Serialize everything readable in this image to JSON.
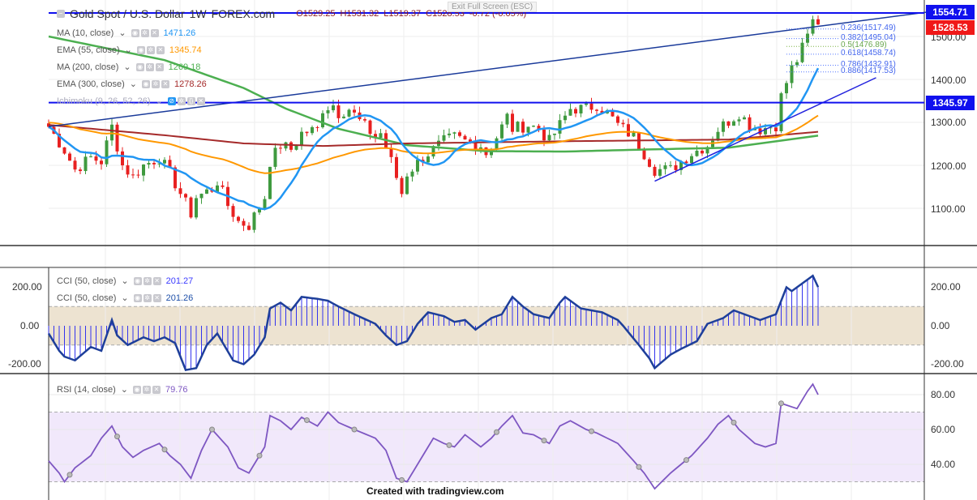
{
  "header": {
    "symbol": "Gold Spot / U.S. Dollar",
    "interval": "1W",
    "source": "FOREX.com",
    "open": "O1529.25",
    "high": "H1531.32",
    "low": "L1519.37",
    "close": "C1528.53",
    "change": "-0.72 (-0.05%)",
    "exit_fullscreen": "Exit Full Screen (ESC)"
  },
  "legends": {
    "ma10": {
      "label": "MA (10, close)",
      "value": "1471.26",
      "color": "#2196f3"
    },
    "ema55": {
      "label": "EMA (55, close)",
      "value": "1345.74",
      "color": "#ff9800"
    },
    "ma200": {
      "label": "MA (200, close)",
      "value": "1269.18",
      "color": "#4caf50"
    },
    "ema300": {
      "label": "EMA (300, close)",
      "value": "1278.26",
      "color": "#a52a2a"
    },
    "ichimoku": {
      "label": "Ichimoku (9, 26, 52, 26)"
    },
    "cci1": {
      "label": "CCI (50, close)",
      "value": "201.27"
    },
    "cci2": {
      "label": "CCI (50, close)",
      "value": "201.26"
    },
    "rsi": {
      "label": "RSI (14, close)",
      "value": "79.76"
    }
  },
  "price_tags": {
    "top": "1554.71",
    "last": "1528.53",
    "support": "1345.97"
  },
  "fib_levels": [
    {
      "label": "0.236(1517.49)",
      "price": 1517.49
    },
    {
      "label": "0.382(1495.04)",
      "price": 1495.04
    },
    {
      "label": "0.5(1476.89)",
      "price": 1476.89
    },
    {
      "label": "0.618(1458.74)",
      "price": 1458.74
    },
    {
      "label": "0.786(1432.91)",
      "price": 1432.91
    },
    {
      "label": "0.886(1417.53)",
      "price": 1417.53
    }
  ],
  "credit": "Created with tradingview.com",
  "chart_data": {
    "type": "line",
    "title": "Gold Spot / U.S. Dollar 1W",
    "price_axis": {
      "ticks": [
        "1500.00",
        "1400.00",
        "1300.00",
        "1200.00",
        "1100.00"
      ],
      "values": [
        1500,
        1400,
        1300,
        1200,
        1100
      ]
    },
    "cci_axis": {
      "ticks": [
        "200.00",
        "0.00",
        "-200.00"
      ],
      "values": [
        200,
        0,
        -200
      ],
      "band": [
        -100,
        100
      ]
    },
    "rsi_axis": {
      "ticks": [
        "80.00",
        "60.00",
        "40.00"
      ],
      "values": [
        80,
        60,
        40
      ],
      "band": [
        30,
        70
      ]
    },
    "weeks": 146,
    "close_path": [
      [
        0,
        1290
      ],
      [
        3,
        1235
      ],
      [
        5,
        1190
      ],
      [
        8,
        1218
      ],
      [
        10,
        1209
      ],
      [
        12,
        1290
      ],
      [
        14,
        1200
      ],
      [
        16,
        1173
      ],
      [
        18,
        1200
      ],
      [
        21,
        1218
      ],
      [
        23,
        1181
      ],
      [
        25,
        1135
      ],
      [
        27,
        1088
      ],
      [
        28,
        1126
      ],
      [
        31,
        1145
      ],
      [
        32,
        1163
      ],
      [
        34,
        1107
      ],
      [
        36,
        1069
      ],
      [
        38,
        1060
      ],
      [
        41,
        1126
      ],
      [
        42,
        1209
      ],
      [
        44,
        1247
      ],
      [
        46,
        1237
      ],
      [
        48,
        1275
      ],
      [
        51,
        1284
      ],
      [
        52,
        1332
      ],
      [
        54,
        1341
      ],
      [
        55,
        1322
      ],
      [
        57,
        1332
      ],
      [
        59,
        1303
      ],
      [
        62,
        1266
      ],
      [
        63,
        1275
      ],
      [
        65,
        1209
      ],
      [
        67,
        1135
      ],
      [
        68,
        1181
      ],
      [
        71,
        1218
      ],
      [
        73,
        1237
      ],
      [
        75,
        1256
      ],
      [
        77,
        1266
      ],
      [
        79,
        1256
      ],
      [
        82,
        1247
      ],
      [
        83,
        1228
      ],
      [
        85,
        1266
      ],
      [
        87,
        1313
      ],
      [
        88,
        1285
      ],
      [
        91,
        1294
      ],
      [
        93,
        1285
      ],
      [
        95,
        1256
      ],
      [
        98,
        1313
      ],
      [
        99,
        1332
      ],
      [
        102,
        1332
      ],
      [
        104,
        1341
      ],
      [
        106,
        1322
      ],
      [
        108,
        1294
      ],
      [
        111,
        1266
      ],
      [
        113,
        1228
      ],
      [
        115,
        1190
      ],
      [
        118,
        1190
      ],
      [
        120,
        1209
      ],
      [
        122,
        1228
      ],
      [
        125,
        1247
      ],
      [
        127,
        1284
      ],
      [
        129,
        1303
      ],
      [
        131,
        1322
      ],
      [
        133,
        1294
      ],
      [
        135,
        1284
      ],
      [
        138,
        1294
      ],
      [
        139,
        1360
      ],
      [
        141,
        1426
      ],
      [
        142,
        1445
      ],
      [
        144,
        1500
      ],
      [
        145,
        1540
      ],
      [
        146,
        1528
      ]
    ],
    "ma200_path": [
      [
        0,
        1500
      ],
      [
        22,
        1445
      ],
      [
        37,
        1380
      ],
      [
        45,
        1332
      ],
      [
        55,
        1285
      ],
      [
        68,
        1247
      ],
      [
        83,
        1233
      ],
      [
        98,
        1232
      ],
      [
        114,
        1237
      ],
      [
        129,
        1241
      ],
      [
        146,
        1269
      ]
    ],
    "ema300_path": [
      [
        0,
        1294
      ],
      [
        22,
        1270
      ],
      [
        37,
        1251
      ],
      [
        52,
        1245
      ],
      [
        68,
        1251
      ],
      [
        98,
        1256
      ],
      [
        129,
        1260
      ],
      [
        146,
        1278
      ]
    ],
    "cci_path": [
      [
        0,
        -40
      ],
      [
        2,
        -130
      ],
      [
        3,
        -160
      ],
      [
        5,
        -180
      ],
      [
        8,
        -110
      ],
      [
        10,
        -130
      ],
      [
        12,
        30
      ],
      [
        13,
        -50
      ],
      [
        15,
        -100
      ],
      [
        18,
        -60
      ],
      [
        20,
        -80
      ],
      [
        22,
        -60
      ],
      [
        24,
        -90
      ],
      [
        26,
        -230
      ],
      [
        28,
        -220
      ],
      [
        30,
        -100
      ],
      [
        32,
        -40
      ],
      [
        35,
        -180
      ],
      [
        37,
        -200
      ],
      [
        39,
        -150
      ],
      [
        41,
        -60
      ],
      [
        42,
        90
      ],
      [
        44,
        120
      ],
      [
        46,
        80
      ],
      [
        48,
        150
      ],
      [
        51,
        140
      ],
      [
        53,
        130
      ],
      [
        55,
        100
      ],
      [
        58,
        60
      ],
      [
        62,
        10
      ],
      [
        64,
        -50
      ],
      [
        66,
        -100
      ],
      [
        68,
        -80
      ],
      [
        70,
        10
      ],
      [
        72,
        70
      ],
      [
        75,
        50
      ],
      [
        77,
        20
      ],
      [
        79,
        30
      ],
      [
        81,
        -20
      ],
      [
        84,
        40
      ],
      [
        86,
        60
      ],
      [
        88,
        150
      ],
      [
        90,
        100
      ],
      [
        92,
        60
      ],
      [
        95,
        40
      ],
      [
        97,
        120
      ],
      [
        98,
        150
      ],
      [
        101,
        90
      ],
      [
        103,
        80
      ],
      [
        105,
        70
      ],
      [
        108,
        30
      ],
      [
        109,
        0
      ],
      [
        112,
        -100
      ],
      [
        114,
        -170
      ],
      [
        115,
        -220
      ],
      [
        118,
        -150
      ],
      [
        120,
        -120
      ],
      [
        123,
        -80
      ],
      [
        125,
        10
      ],
      [
        128,
        40
      ],
      [
        130,
        80
      ],
      [
        132,
        60
      ],
      [
        135,
        30
      ],
      [
        137,
        50
      ],
      [
        138,
        60
      ],
      [
        140,
        200
      ],
      [
        141,
        180
      ],
      [
        144,
        240
      ],
      [
        145,
        260
      ],
      [
        146,
        201
      ]
    ],
    "rsi_path": [
      [
        0,
        42
      ],
      [
        2,
        35
      ],
      [
        3,
        30
      ],
      [
        5,
        38
      ],
      [
        8,
        45
      ],
      [
        10,
        55
      ],
      [
        12,
        62
      ],
      [
        14,
        50
      ],
      [
        16,
        44
      ],
      [
        18,
        48
      ],
      [
        21,
        52
      ],
      [
        23,
        45
      ],
      [
        25,
        40
      ],
      [
        27,
        32
      ],
      [
        29,
        48
      ],
      [
        31,
        60
      ],
      [
        34,
        50
      ],
      [
        36,
        38
      ],
      [
        38,
        35
      ],
      [
        41,
        50
      ],
      [
        42,
        68
      ],
      [
        44,
        65
      ],
      [
        46,
        60
      ],
      [
        48,
        67
      ],
      [
        51,
        62
      ],
      [
        53,
        70
      ],
      [
        55,
        64
      ],
      [
        58,
        60
      ],
      [
        62,
        55
      ],
      [
        64,
        48
      ],
      [
        66,
        32
      ],
      [
        68,
        30
      ],
      [
        71,
        45
      ],
      [
        73,
        55
      ],
      [
        75,
        52
      ],
      [
        77,
        50
      ],
      [
        79,
        57
      ],
      [
        82,
        50
      ],
      [
        84,
        55
      ],
      [
        86,
        62
      ],
      [
        88,
        68
      ],
      [
        90,
        58
      ],
      [
        92,
        57
      ],
      [
        95,
        52
      ],
      [
        97,
        62
      ],
      [
        99,
        65
      ],
      [
        102,
        60
      ],
      [
        104,
        58
      ],
      [
        106,
        55
      ],
      [
        108,
        52
      ],
      [
        111,
        42
      ],
      [
        113,
        35
      ],
      [
        115,
        26
      ],
      [
        118,
        35
      ],
      [
        120,
        40
      ],
      [
        122,
        45
      ],
      [
        125,
        55
      ],
      [
        127,
        63
      ],
      [
        129,
        68
      ],
      [
        131,
        60
      ],
      [
        134,
        52
      ],
      [
        136,
        50
      ],
      [
        138,
        52
      ],
      [
        139,
        75
      ],
      [
        142,
        72
      ],
      [
        144,
        82
      ],
      [
        145,
        86
      ],
      [
        146,
        80
      ]
    ],
    "trendlines": {
      "upper": [
        [
          0,
          1290
        ],
        [
          175,
          1570
        ]
      ],
      "lower": [
        [
          115,
          1163
        ],
        [
          157,
          1404
        ]
      ]
    },
    "horizontal_levels": [
      1554.71,
      1345.97
    ]
  }
}
